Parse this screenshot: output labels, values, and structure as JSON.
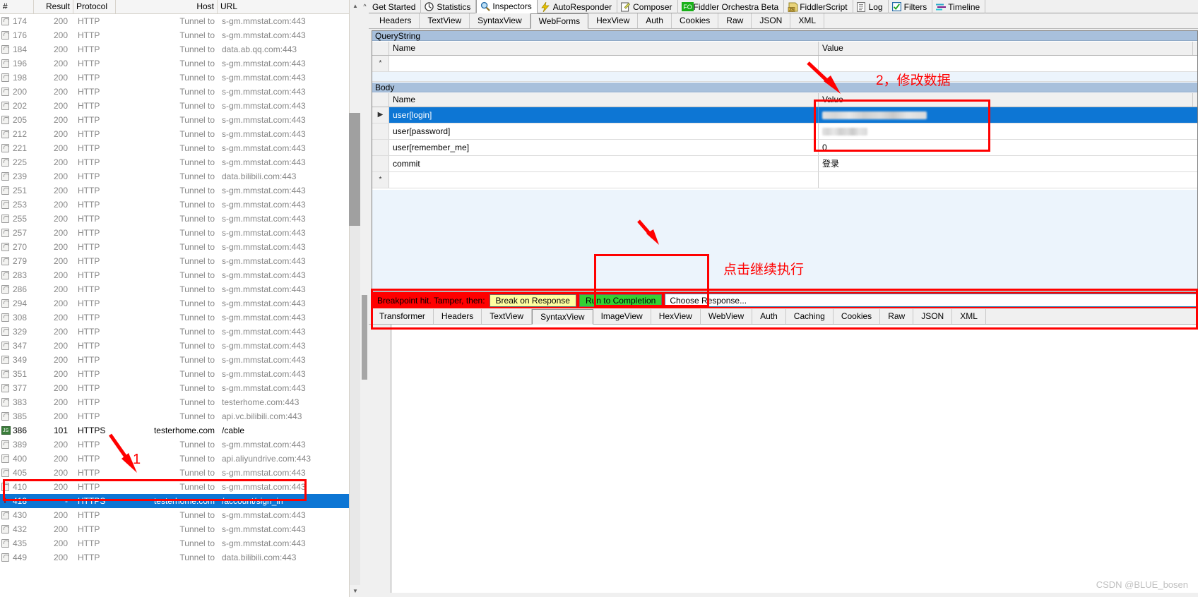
{
  "app": {
    "name": "Fiddler",
    "accent_red": "#ff0000",
    "accent_blue": "#0d76d4",
    "accent_green": "#33d133",
    "accent_yellow": "#ffffa0"
  },
  "session_list": {
    "columns": [
      "#",
      "Result",
      "Protocol",
      "Host",
      "URL"
    ],
    "scroll_up_icon": "chevron-up-icon",
    "scroll_down_icon": "chevron-down-icon",
    "rows": [
      {
        "icon": "lock-icon",
        "num": "174",
        "result": "200",
        "protocol": "HTTP",
        "host": "Tunnel to",
        "url": "s-gm.mmstat.com:443",
        "style": "normal"
      },
      {
        "icon": "lock-icon",
        "num": "176",
        "result": "200",
        "protocol": "HTTP",
        "host": "Tunnel to",
        "url": "s-gm.mmstat.com:443",
        "style": "normal"
      },
      {
        "icon": "lock-icon",
        "num": "184",
        "result": "200",
        "protocol": "HTTP",
        "host": "Tunnel to",
        "url": "data.ab.qq.com:443",
        "style": "normal"
      },
      {
        "icon": "lock-icon",
        "num": "196",
        "result": "200",
        "protocol": "HTTP",
        "host": "Tunnel to",
        "url": "s-gm.mmstat.com:443",
        "style": "normal"
      },
      {
        "icon": "lock-icon",
        "num": "198",
        "result": "200",
        "protocol": "HTTP",
        "host": "Tunnel to",
        "url": "s-gm.mmstat.com:443",
        "style": "normal"
      },
      {
        "icon": "lock-icon",
        "num": "200",
        "result": "200",
        "protocol": "HTTP",
        "host": "Tunnel to",
        "url": "s-gm.mmstat.com:443",
        "style": "normal"
      },
      {
        "icon": "lock-icon",
        "num": "202",
        "result": "200",
        "protocol": "HTTP",
        "host": "Tunnel to",
        "url": "s-gm.mmstat.com:443",
        "style": "normal"
      },
      {
        "icon": "lock-icon",
        "num": "205",
        "result": "200",
        "protocol": "HTTP",
        "host": "Tunnel to",
        "url": "s-gm.mmstat.com:443",
        "style": "normal"
      },
      {
        "icon": "lock-icon",
        "num": "212",
        "result": "200",
        "protocol": "HTTP",
        "host": "Tunnel to",
        "url": "s-gm.mmstat.com:443",
        "style": "normal"
      },
      {
        "icon": "lock-icon",
        "num": "221",
        "result": "200",
        "protocol": "HTTP",
        "host": "Tunnel to",
        "url": "s-gm.mmstat.com:443",
        "style": "normal"
      },
      {
        "icon": "lock-icon",
        "num": "225",
        "result": "200",
        "protocol": "HTTP",
        "host": "Tunnel to",
        "url": "s-gm.mmstat.com:443",
        "style": "normal"
      },
      {
        "icon": "lock-icon",
        "num": "239",
        "result": "200",
        "protocol": "HTTP",
        "host": "Tunnel to",
        "url": "data.bilibili.com:443",
        "style": "normal"
      },
      {
        "icon": "lock-icon",
        "num": "251",
        "result": "200",
        "protocol": "HTTP",
        "host": "Tunnel to",
        "url": "s-gm.mmstat.com:443",
        "style": "normal"
      },
      {
        "icon": "lock-icon",
        "num": "253",
        "result": "200",
        "protocol": "HTTP",
        "host": "Tunnel to",
        "url": "s-gm.mmstat.com:443",
        "style": "normal"
      },
      {
        "icon": "lock-icon",
        "num": "255",
        "result": "200",
        "protocol": "HTTP",
        "host": "Tunnel to",
        "url": "s-gm.mmstat.com:443",
        "style": "normal"
      },
      {
        "icon": "lock-icon",
        "num": "257",
        "result": "200",
        "protocol": "HTTP",
        "host": "Tunnel to",
        "url": "s-gm.mmstat.com:443",
        "style": "normal"
      },
      {
        "icon": "lock-icon",
        "num": "270",
        "result": "200",
        "protocol": "HTTP",
        "host": "Tunnel to",
        "url": "s-gm.mmstat.com:443",
        "style": "normal"
      },
      {
        "icon": "lock-icon",
        "num": "279",
        "result": "200",
        "protocol": "HTTP",
        "host": "Tunnel to",
        "url": "s-gm.mmstat.com:443",
        "style": "normal"
      },
      {
        "icon": "lock-icon",
        "num": "283",
        "result": "200",
        "protocol": "HTTP",
        "host": "Tunnel to",
        "url": "s-gm.mmstat.com:443",
        "style": "normal"
      },
      {
        "icon": "lock-icon",
        "num": "286",
        "result": "200",
        "protocol": "HTTP",
        "host": "Tunnel to",
        "url": "s-gm.mmstat.com:443",
        "style": "normal"
      },
      {
        "icon": "lock-icon",
        "num": "294",
        "result": "200",
        "protocol": "HTTP",
        "host": "Tunnel to",
        "url": "s-gm.mmstat.com:443",
        "style": "normal"
      },
      {
        "icon": "lock-icon",
        "num": "308",
        "result": "200",
        "protocol": "HTTP",
        "host": "Tunnel to",
        "url": "s-gm.mmstat.com:443",
        "style": "normal"
      },
      {
        "icon": "lock-icon",
        "num": "329",
        "result": "200",
        "protocol": "HTTP",
        "host": "Tunnel to",
        "url": "s-gm.mmstat.com:443",
        "style": "normal"
      },
      {
        "icon": "lock-icon",
        "num": "347",
        "result": "200",
        "protocol": "HTTP",
        "host": "Tunnel to",
        "url": "s-gm.mmstat.com:443",
        "style": "normal"
      },
      {
        "icon": "lock-icon",
        "num": "349",
        "result": "200",
        "protocol": "HTTP",
        "host": "Tunnel to",
        "url": "s-gm.mmstat.com:443",
        "style": "normal"
      },
      {
        "icon": "lock-icon",
        "num": "351",
        "result": "200",
        "protocol": "HTTP",
        "host": "Tunnel to",
        "url": "s-gm.mmstat.com:443",
        "style": "normal"
      },
      {
        "icon": "lock-icon",
        "num": "377",
        "result": "200",
        "protocol": "HTTP",
        "host": "Tunnel to",
        "url": "s-gm.mmstat.com:443",
        "style": "normal"
      },
      {
        "icon": "lock-icon",
        "num": "383",
        "result": "200",
        "protocol": "HTTP",
        "host": "Tunnel to",
        "url": "testerhome.com:443",
        "style": "normal"
      },
      {
        "icon": "lock-icon",
        "num": "385",
        "result": "200",
        "protocol": "HTTP",
        "host": "Tunnel to",
        "url": "api.vc.bilibili.com:443",
        "style": "normal"
      },
      {
        "icon": "websocket-icon",
        "num": "386",
        "result": "101",
        "protocol": "HTTPS",
        "host": "testerhome.com",
        "url": "/cable",
        "style": "dark"
      },
      {
        "icon": "lock-icon",
        "num": "389",
        "result": "200",
        "protocol": "HTTP",
        "host": "Tunnel to",
        "url": "s-gm.mmstat.com:443",
        "style": "normal"
      },
      {
        "icon": "lock-icon",
        "num": "400",
        "result": "200",
        "protocol": "HTTP",
        "host": "Tunnel to",
        "url": "api.aliyundrive.com:443",
        "style": "normal"
      },
      {
        "icon": "lock-icon",
        "num": "405",
        "result": "200",
        "protocol": "HTTP",
        "host": "Tunnel to",
        "url": "s-gm.mmstat.com:443",
        "style": "normal"
      },
      {
        "icon": "lock-icon",
        "num": "410",
        "result": "200",
        "protocol": "HTTP",
        "host": "Tunnel to",
        "url": "s-gm.mmstat.com:443",
        "style": "normal"
      },
      {
        "icon": "breakpoint-icon",
        "num": "418",
        "result": "-",
        "protocol": "HTTPS",
        "host": "testerhome.com",
        "url": "/account/sign_in",
        "style": "selected"
      },
      {
        "icon": "lock-icon",
        "num": "430",
        "result": "200",
        "protocol": "HTTP",
        "host": "Tunnel to",
        "url": "s-gm.mmstat.com:443",
        "style": "normal"
      },
      {
        "icon": "lock-icon",
        "num": "432",
        "result": "200",
        "protocol": "HTTP",
        "host": "Tunnel to",
        "url": "s-gm.mmstat.com:443",
        "style": "normal"
      },
      {
        "icon": "lock-icon",
        "num": "435",
        "result": "200",
        "protocol": "HTTP",
        "host": "Tunnel to",
        "url": "s-gm.mmstat.com:443",
        "style": "normal"
      },
      {
        "icon": "lock-icon",
        "num": "449",
        "result": "200",
        "protocol": "HTTP",
        "host": "Tunnel to",
        "url": "data.bilibili.com:443",
        "style": "normal"
      }
    ]
  },
  "main_tabs": [
    {
      "label": "Get Started",
      "icon": "",
      "active": false
    },
    {
      "label": "Statistics",
      "icon": "statistics-icon",
      "active": false
    },
    {
      "label": "Inspectors",
      "icon": "magnifier-icon",
      "active": true
    },
    {
      "label": "AutoResponder",
      "icon": "lightning-icon",
      "active": false
    },
    {
      "label": "Composer",
      "icon": "compose-icon",
      "active": false
    },
    {
      "label": "Fiddler Orchestra Beta",
      "icon": "orchestra-icon",
      "active": false
    },
    {
      "label": "FiddlerScript",
      "icon": "script-icon",
      "active": false
    },
    {
      "label": "Log",
      "icon": "log-icon",
      "active": false
    },
    {
      "label": "Filters",
      "icon": "filters-checkbox-icon",
      "active": false
    },
    {
      "label": "Timeline",
      "icon": "timeline-icon",
      "active": false
    }
  ],
  "request_tabs": [
    {
      "label": "Headers",
      "active": false
    },
    {
      "label": "TextView",
      "active": false
    },
    {
      "label": "SyntaxView",
      "active": false
    },
    {
      "label": "WebForms",
      "active": true
    },
    {
      "label": "HexView",
      "active": false
    },
    {
      "label": "Auth",
      "active": false
    },
    {
      "label": "Cookies",
      "active": false
    },
    {
      "label": "Raw",
      "active": false
    },
    {
      "label": "JSON",
      "active": false
    },
    {
      "label": "XML",
      "active": false
    }
  ],
  "webforms": {
    "querystring": {
      "caption": "QueryString",
      "columns": [
        "Name",
        "Value"
      ],
      "rows": [
        {
          "marker": "*",
          "name": "",
          "value": ""
        }
      ]
    },
    "body": {
      "caption": "Body",
      "columns": [
        "Name",
        "Value"
      ],
      "rows": [
        {
          "marker": "▶",
          "name": "user[login]",
          "value": "",
          "redacted": true,
          "redact_width": 148,
          "selected": true
        },
        {
          "marker": "",
          "name": "user[password]",
          "value": "",
          "redacted": true,
          "redact_width": 64,
          "selected": false
        },
        {
          "marker": "",
          "name": "user[remember_me]",
          "value": "0",
          "redacted": false,
          "selected": false
        },
        {
          "marker": "",
          "name": "commit",
          "value": "登录",
          "redacted": false,
          "selected": false
        },
        {
          "marker": "*",
          "name": "",
          "value": "",
          "redacted": false,
          "selected": false
        }
      ]
    }
  },
  "breakpoint_bar": {
    "message": "Breakpoint hit. Tamper, then:",
    "break_on_response_label": "Break on Response",
    "run_to_completion_label": "Run to Completion",
    "choose_response_label": "Choose Response..."
  },
  "response_tabs": [
    {
      "label": "Transformer",
      "active": false
    },
    {
      "label": "Headers",
      "active": false
    },
    {
      "label": "TextView",
      "active": false
    },
    {
      "label": "SyntaxView",
      "active": true
    },
    {
      "label": "ImageView",
      "active": false
    },
    {
      "label": "HexView",
      "active": false
    },
    {
      "label": "WebView",
      "active": false
    },
    {
      "label": "Auth",
      "active": false
    },
    {
      "label": "Caching",
      "active": false
    },
    {
      "label": "Cookies",
      "active": false
    },
    {
      "label": "Raw",
      "active": false
    },
    {
      "label": "JSON",
      "active": false
    },
    {
      "label": "XML",
      "active": false
    }
  ],
  "annotations": [
    {
      "id": "step-1",
      "text": "1"
    },
    {
      "id": "step-2",
      "text": "2，修改数据"
    },
    {
      "id": "step-3",
      "text": "点击继续执行"
    }
  ],
  "watermark": "CSDN @BLUE_bosen"
}
